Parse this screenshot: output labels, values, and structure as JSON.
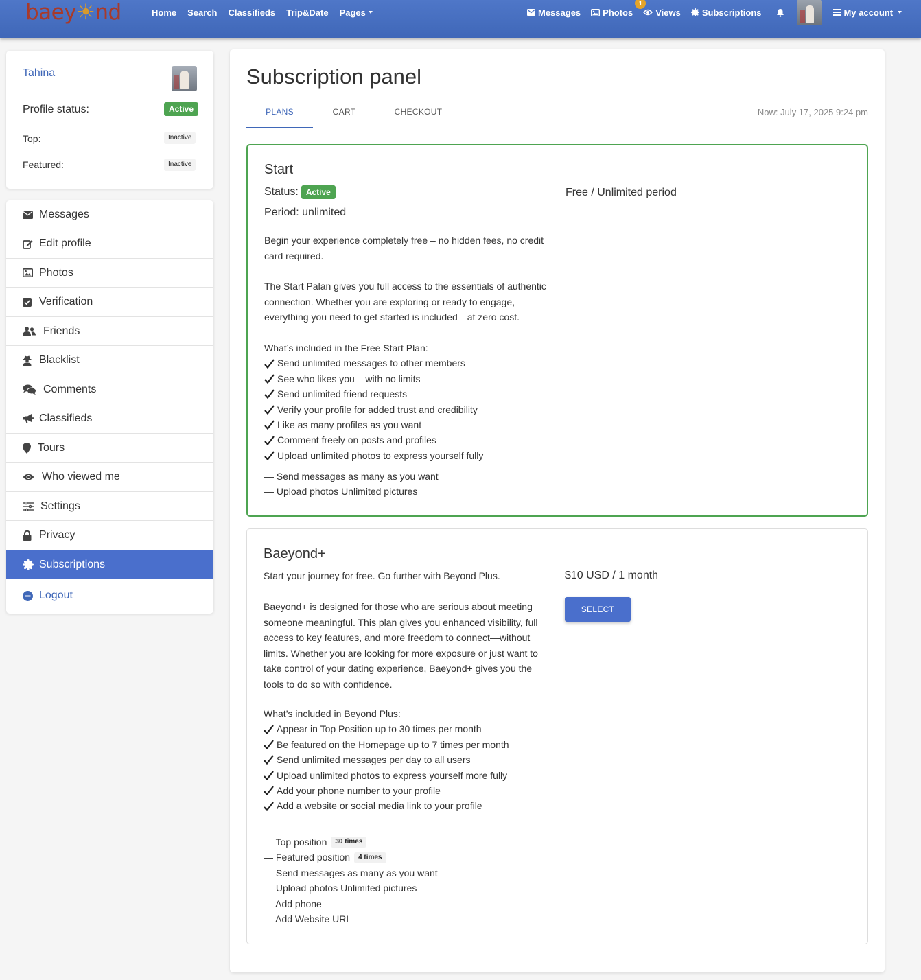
{
  "navbar": {
    "logo": {
      "part1": "baey",
      "part2": "nd"
    },
    "links": [
      {
        "label": "Home",
        "icon": "",
        "caret": false
      },
      {
        "label": "Search",
        "icon": "",
        "caret": false
      },
      {
        "label": "Classifieds",
        "icon": "",
        "caret": false
      },
      {
        "label": "Trip&Date",
        "icon": "",
        "caret": false
      },
      {
        "label": "Pages",
        "icon": "",
        "caret": true
      }
    ],
    "right": {
      "messages": "Messages",
      "photos": "Photos",
      "views": "Views",
      "views_badge": "1",
      "subscriptions": "Subscriptions",
      "my_account": "My account"
    },
    "colors": {
      "bar": "#4a72c4",
      "logo": "#a83a2a",
      "badge": "#e5a42a"
    }
  },
  "profile": {
    "name": "Tahina",
    "status_label": "Profile status:",
    "status_value": "Active",
    "top_label": "Top:",
    "top_value": "Inactive",
    "featured_label": "Featured:",
    "featured_value": "Inactive"
  },
  "menu": {
    "items": [
      {
        "label": "Messages",
        "icon": "envelope-icon"
      },
      {
        "label": "Edit profile",
        "icon": "edit-icon"
      },
      {
        "label": "Photos",
        "icon": "image-icon"
      },
      {
        "label": "Verification",
        "icon": "check-square-icon"
      },
      {
        "label": "Friends",
        "icon": "users-icon"
      },
      {
        "label": "Blacklist",
        "icon": "user-secret-icon"
      },
      {
        "label": "Comments",
        "icon": "comments-icon"
      },
      {
        "label": "Classifieds",
        "icon": "bullhorn-icon"
      },
      {
        "label": "Tours",
        "icon": "map-marker-icon"
      },
      {
        "label": "Who viewed me",
        "icon": "eye-icon"
      },
      {
        "label": "Settings",
        "icon": "sliders-icon"
      },
      {
        "label": "Privacy",
        "icon": "lock-icon"
      },
      {
        "label": "Subscriptions",
        "icon": "certificate-icon"
      },
      {
        "label": "Logout",
        "icon": "minus-circle-icon"
      }
    ],
    "active_item": "Subscriptions",
    "active_color": "#4a6fcc"
  },
  "main": {
    "title": "Subscription panel",
    "tabs": [
      "PLANS",
      "CART",
      "CHECKOUT"
    ],
    "active_tab": "PLANS",
    "now": "Now: July 17, 2025 9:24 pm",
    "plans": {
      "start": {
        "title": "Start",
        "status_label": "Status:",
        "status_value": "Active",
        "period": "Period: unlimited",
        "price": "Free / Unlimited period",
        "desc1": "Begin your experience completely free – no hidden fees, no credit card required.",
        "desc2": "The Start Palan gives you full access to the essentials of authentic connection. Whether you are exploring or ready to engage, everything you need to get started is included—at zero cost.",
        "included_title": "What’s included in the Free Start Plan:",
        "features": [
          "Send unlimited messages to other members",
          "See who likes you – with no limits",
          "Send unlimited friend requests",
          "Verify your profile for added trust and credibility",
          "Like as many profiles as you want",
          "Comment freely on posts and profiles",
          "Upload unlimited photos to express yourself fully"
        ],
        "limits": [
          "— Send messages as many as you want",
          "— Upload photos Unlimited pictures"
        ],
        "border_color": "#4ea451"
      },
      "plus": {
        "title": "Baeyond+",
        "tagline": "Start your journey for free. Go further with Beyond Plus.",
        "price": "$10 USD / 1 month",
        "select_label": "SELECT",
        "desc": "Baeyond+ is designed for those who are serious about meeting someone meaningful. This plan gives you enhanced visibility, full access to key features, and more freedom to connect—without limits. Whether you are looking for more exposure or just want to take control of your dating experience, Baeyond+ gives you the tools to do so with confidence.",
        "included_title": "What’s included in Beyond Plus:",
        "features": [
          "Appear in Top Position up to 30 times per month",
          "Be featured on the Homepage up to 7 times per month",
          "Send unlimited messages per day to all users",
          "Upload unlimited photos to express yourself more fully",
          "Add your phone number to your profile",
          "Add a website or social media link to your profile"
        ],
        "limits": {
          "top_label": "— Top position",
          "top_value": "30 times",
          "featured_label": "— Featured position",
          "featured_value": "4 times",
          "messages": "— Send messages as many as you want",
          "photos": "— Upload photos Unlimited pictures",
          "phone": "— Add phone",
          "website": "— Add Website URL"
        }
      }
    }
  }
}
